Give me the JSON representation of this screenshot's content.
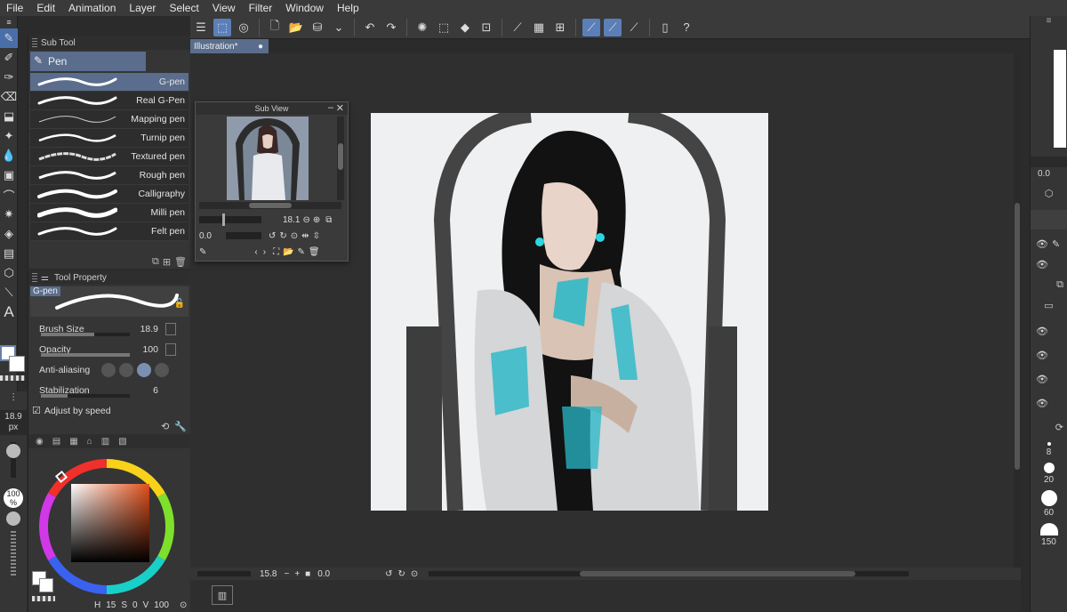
{
  "menu": [
    "File",
    "Edit",
    "Animation",
    "Layer",
    "Select",
    "View",
    "Filter",
    "Window",
    "Help"
  ],
  "subtool_panel": {
    "tab_label": "Sub Tool",
    "group_label": "Pen",
    "brushes": [
      {
        "name": "G-pen",
        "selected": true
      },
      {
        "name": "Real G-Pen",
        "selected": false
      },
      {
        "name": "Mapping pen",
        "selected": false
      },
      {
        "name": "Turnip pen",
        "selected": false
      },
      {
        "name": "Textured pen",
        "selected": false
      },
      {
        "name": "Rough pen",
        "selected": false
      },
      {
        "name": "Calligraphy",
        "selected": false
      },
      {
        "name": "Milli pen",
        "selected": false
      },
      {
        "name": "Felt pen",
        "selected": false
      }
    ]
  },
  "tool_property": {
    "tab_label": "Tool Property",
    "brush_name": "G-pen",
    "brush_size_label": "Brush Size",
    "brush_size_value": "18.9",
    "opacity_label": "Opacity",
    "opacity_value": "100",
    "anti_aliasing_label": "Anti-aliasing",
    "stabilization_label": "Stabilization",
    "stabilization_value": "6",
    "adjust_speed_label": "Adjust by speed"
  },
  "left_strip": {
    "brush_size_display": "18.9",
    "brush_size_unit": "px",
    "opacity_display": "100",
    "opacity_unit": "%"
  },
  "color_panel": {
    "footer_h": "15",
    "footer_s": "0",
    "footer_v": "100"
  },
  "subview": {
    "title": "Sub View",
    "zoom_value": "18.1",
    "rotate_value": "0.0"
  },
  "document": {
    "tab_label": "Illustration*"
  },
  "statusbar": {
    "zoom_value": "15.8",
    "rotate_value": "0.0"
  },
  "right_panel": {
    "value_00": "0.0",
    "brush_sizes": [
      "8",
      "20",
      "60",
      "150"
    ]
  },
  "colors": {
    "accent": "#5a6d8c",
    "panel": "#353535",
    "canvas_bg": "#2f2f2f",
    "artboard": "#eef0f1"
  }
}
